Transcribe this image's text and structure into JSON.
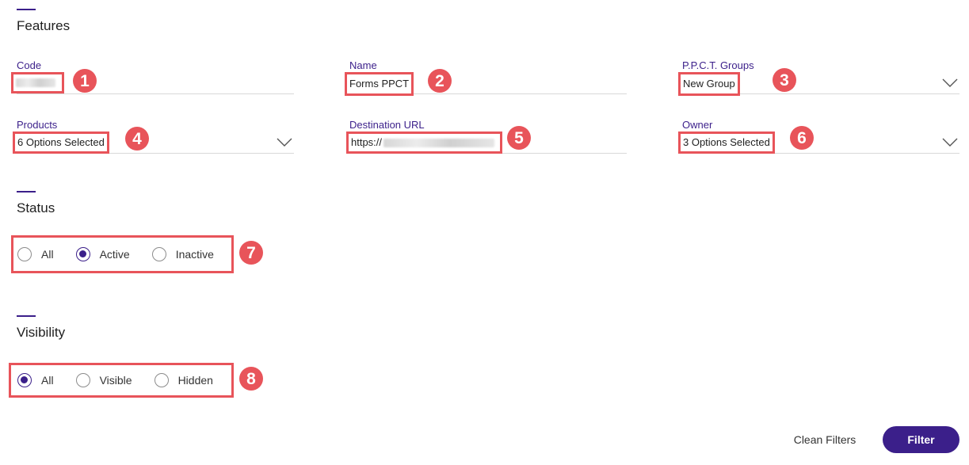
{
  "sections": {
    "features": "Features",
    "status": "Status",
    "visibility": "Visibility"
  },
  "fields": {
    "code": {
      "label": "Code",
      "value": ""
    },
    "name": {
      "label": "Name",
      "value": "Forms PPCT"
    },
    "ppct_groups": {
      "label": "P.P.C.T. Groups",
      "value": "New Group"
    },
    "products": {
      "label": "Products",
      "value": "6 Options Selected"
    },
    "destination_url": {
      "label": "Destination URL",
      "value": "https://"
    },
    "owner": {
      "label": "Owner",
      "value": "3 Options Selected"
    }
  },
  "status": {
    "options": [
      "All",
      "Active",
      "Inactive"
    ],
    "selected": "Active"
  },
  "visibility": {
    "options": [
      "All",
      "Visible",
      "Hidden"
    ],
    "selected": "All"
  },
  "badges": [
    "1",
    "2",
    "3",
    "4",
    "5",
    "6",
    "7",
    "8"
  ],
  "buttons": {
    "clean": "Clean Filters",
    "filter": "Filter"
  },
  "colors": {
    "accent": "#3b1f8a",
    "highlight": "#e8545a"
  },
  "icons": {
    "dropdown": "chevron-down-icon",
    "radio_on": "radio-checked-icon",
    "radio_off": "radio-unchecked-icon"
  }
}
